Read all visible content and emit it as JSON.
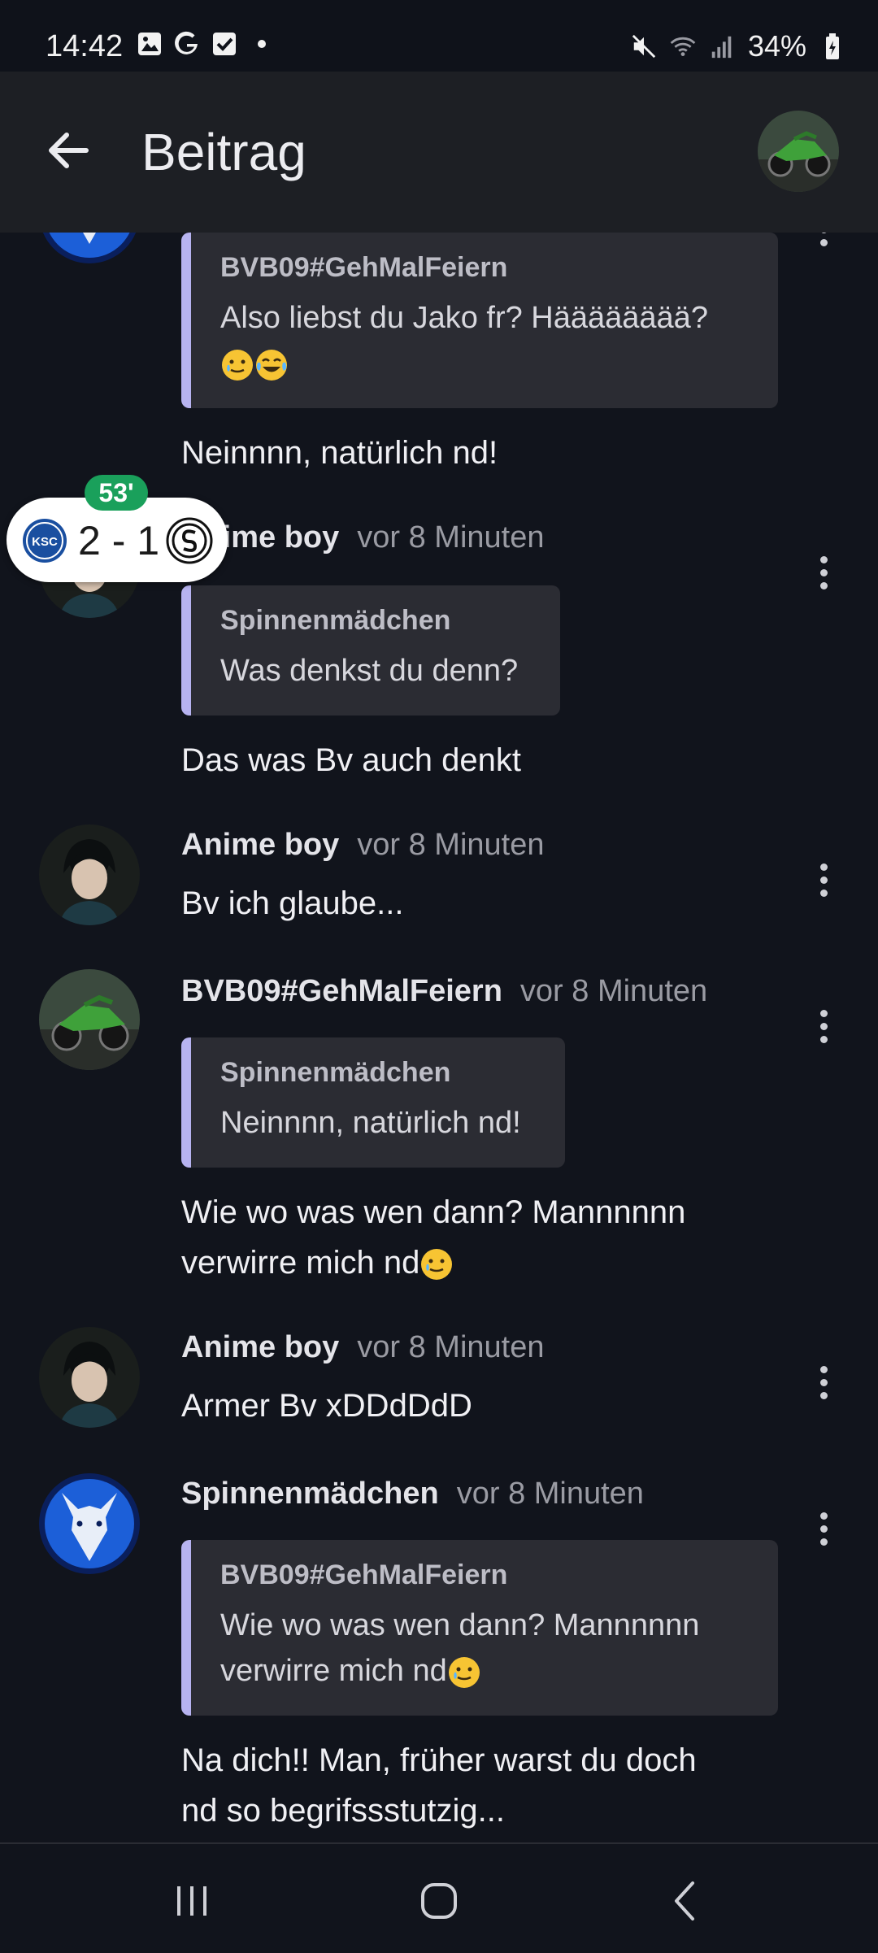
{
  "status": {
    "time": "14:42",
    "battery": "34%",
    "left_icons": [
      "gallery-icon",
      "google-icon",
      "check-icon",
      "dot-icon"
    ],
    "right_icons": [
      "mute-icon",
      "wifi-icon",
      "signal-icon",
      "battery-icon"
    ]
  },
  "header": {
    "title": "Beitrag"
  },
  "score_widget": {
    "minute": "53'",
    "score": "2 - 1",
    "home_badge": "KSC",
    "home_color": "#1a4fa0"
  },
  "posts": [
    {
      "quote_author": "BVB09#GehMalFeiern",
      "quote_text": "Also liebst du Jako fr? Hääääääää?",
      "message": "Neinnnn, natürlich nd!"
    },
    {
      "author": "Anime boy",
      "time": "vor 8 Minuten",
      "quote_author": "Spinnenmädchen",
      "quote_text": "Was denkst du denn?",
      "message": "Das was Bv auch denkt"
    },
    {
      "author": "Anime boy",
      "time": "vor 8 Minuten",
      "message": "Bv ich glaube..."
    },
    {
      "author": "BVB09#GehMalFeiern",
      "time": "vor 8 Minuten",
      "quote_author": "Spinnenmädchen",
      "quote_text": "Neinnnn, natürlich nd!",
      "message_line1": "Wie wo was wen dann? Mannnnnn",
      "message_line2": "verwirre mich nd"
    },
    {
      "author": "Anime boy",
      "time": "vor 8 Minuten",
      "message": "Armer Bv xDDdDdD"
    },
    {
      "author": "Spinnenmädchen",
      "time": "vor 8 Minuten",
      "quote_author": "BVB09#GehMalFeiern",
      "quote_text_line1": "Wie wo was wen dann? Mannnnnn",
      "quote_text_line2": "verwirre mich nd",
      "message_line1": "Na dich!! Man, früher warst du doch",
      "message_line2": "nd so begrifssstutzig..."
    }
  ],
  "colors": {
    "background": "#11141c",
    "quote_bar": "#b7b3f0",
    "minute_badge": "#1aa05b"
  }
}
